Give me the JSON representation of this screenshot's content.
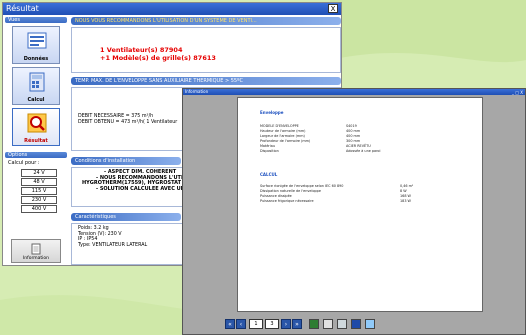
{
  "window": {
    "title": "Résultat",
    "close": "X"
  },
  "left": {
    "views_label": "Vues",
    "btn_donnees": "Données",
    "btn_calcul": "Calcul",
    "btn_resultat": "Résultat",
    "options_label": "Options",
    "calcul_pour": "Calcul pour :",
    "voltages": [
      "24 V",
      "48 V",
      "115 V",
      "230 V",
      "400 V"
    ],
    "info_label": "Information"
  },
  "main": {
    "banner": "NOUS VOUS RECOMMANDONS L'UTILISATION D'UN SYSTEME DE VENTI...",
    "line1": "1 Ventilateur(s) 87904",
    "line2": "+1 Modèle(s) de grille(s) 87613",
    "temp_header": "TEMP. MAX. DE L'ENVELOPPE SANS AUXILIAIRE THERMIQUE > 55ºC",
    "debit_necessaire": "DEBIT NECESSAIRE =  375 m³/h",
    "debit_obtenu": "DEBIT OBTENU =  473 m³/h( 1 Ventilateur",
    "cond_header": "Conditions d'installation",
    "cond_lines": [
      "- ASPECT DIM. COHERENT",
      "- NOUS RECOMMANDONS L'UTILI",
      "HYGROTHERM(17559), HYGROSTAT (1",
      "- SOLUTION CALCULEE AVEC UN"
    ],
    "carac_header": "Caractéristiques",
    "carac_lines": [
      "Poids:  3.2 kg",
      "Tension (V):  230 V",
      "IP : IP54",
      "Type: VENTILATEUR LATERAL"
    ]
  },
  "info_window": {
    "title": "Information",
    "controls": "_ □ X",
    "section1": "Enveloppe",
    "rows1": [
      [
        "MODELE D'ENVELOPPE",
        "S4019"
      ],
      [
        "Hauteur de l'armoire (mm)",
        "400 mm"
      ],
      [
        "Largeur de l'armoire (mm)",
        "400 mm"
      ],
      [
        "Profondeur de l'armoire (mm)",
        "300 mm"
      ],
      [
        "Matériau",
        "ACIER REVÊTU"
      ],
      [
        "Disposition",
        "Adossée à une paroi"
      ]
    ],
    "section2": "CALCUL",
    "rows2": [
      [
        "Surface rionigée de l'enveloppe selon IEC 60 890",
        "0,46 m²"
      ],
      [
        "Dissipation naturelle de l'enveloppe",
        "8 W"
      ],
      [
        "Puissance dissipée",
        "168 W"
      ],
      [
        "Puissance frigorique nécessaire",
        "183 W"
      ]
    ],
    "page_current": "1",
    "page_total": "3"
  },
  "colors": {
    "accent": "#3b6cc4",
    "background": "#d6ecb3",
    "alert": "#e60000"
  }
}
